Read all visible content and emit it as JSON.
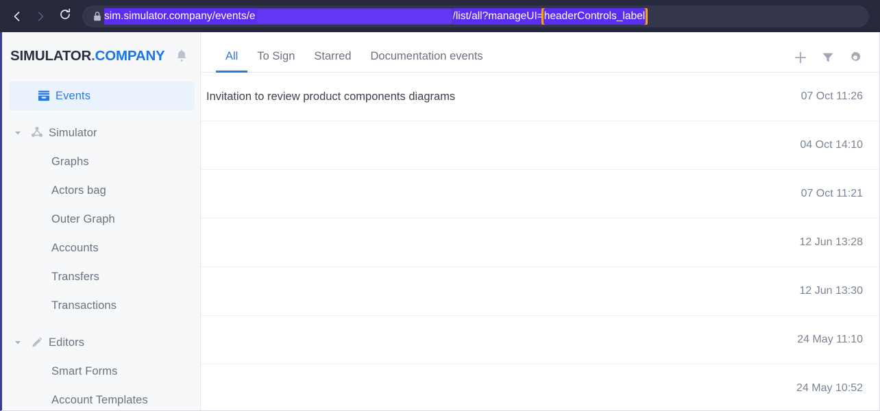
{
  "browser": {
    "back_icon": "chevron-left-icon",
    "forward_icon": "chevron-right-icon",
    "reload_icon": "reload-icon",
    "lock_icon": "lock-icon",
    "url_prefix": "sim.simulator.company/events/e",
    "url_redacted": "",
    "url_suffix": "/list/all?manageUI=",
    "url_highlighted": "headerControls_label",
    "highlight_color": "#e8a33d",
    "selection_color": "#5a2df0",
    "chrome_bg": "#26283b"
  },
  "sidebar": {
    "brand_main": "SIMULATOR",
    "brand_accent": ".COMPANY",
    "bell_icon": "bell-icon",
    "accent_color": "#1a73e8",
    "items": [
      {
        "label": "Events",
        "icon": "archive-icon",
        "level": "top",
        "active": true,
        "caret": ""
      },
      {
        "label": "Simulator",
        "icon": "nodes-icon",
        "level": "top",
        "active": false,
        "caret": "chevron-down-icon"
      },
      {
        "label": "Graphs",
        "icon": "",
        "level": "child",
        "active": false,
        "caret": ""
      },
      {
        "label": "Actors bag",
        "icon": "",
        "level": "child",
        "active": false,
        "caret": ""
      },
      {
        "label": "Outer Graph",
        "icon": "",
        "level": "child",
        "active": false,
        "caret": ""
      },
      {
        "label": "Accounts",
        "icon": "",
        "level": "child",
        "active": false,
        "caret": ""
      },
      {
        "label": "Transfers",
        "icon": "",
        "level": "child",
        "active": false,
        "caret": ""
      },
      {
        "label": "Transactions",
        "icon": "",
        "level": "child",
        "active": false,
        "caret": ""
      },
      {
        "label": "Editors",
        "icon": "pencil-icon",
        "level": "top",
        "active": false,
        "caret": "chevron-down-icon"
      },
      {
        "label": "Smart Forms",
        "icon": "",
        "level": "child",
        "active": false,
        "caret": ""
      },
      {
        "label": "Account Templates",
        "icon": "",
        "level": "child",
        "active": false,
        "caret": ""
      }
    ]
  },
  "main": {
    "tabs": [
      {
        "label": "All",
        "active": true
      },
      {
        "label": "To Sign",
        "active": false
      },
      {
        "label": "Starred",
        "active": false
      },
      {
        "label": "Documentation events",
        "active": false
      }
    ],
    "tools": [
      {
        "icon": "plus-icon",
        "name": "add-event-button"
      },
      {
        "icon": "filter-icon",
        "name": "filter-button"
      },
      {
        "icon": "gear-icon",
        "name": "settings-button"
      }
    ],
    "events": [
      {
        "title": "Invitation to review product components diagrams",
        "date": "07 Oct 11:26",
        "redacted": false
      },
      {
        "title": "",
        "date": "04 Oct 14:10",
        "redacted": true
      },
      {
        "title": "",
        "date": "07 Oct 11:21",
        "redacted": true
      },
      {
        "title": "",
        "date": "12 Jun 13:28",
        "redacted": true
      },
      {
        "title": "",
        "date": "12 Jun 13:30",
        "redacted": true
      },
      {
        "title": "",
        "date": "24 May 11:10",
        "redacted": true
      },
      {
        "title": "",
        "date": "24 May 10:52",
        "redacted": true
      }
    ]
  }
}
